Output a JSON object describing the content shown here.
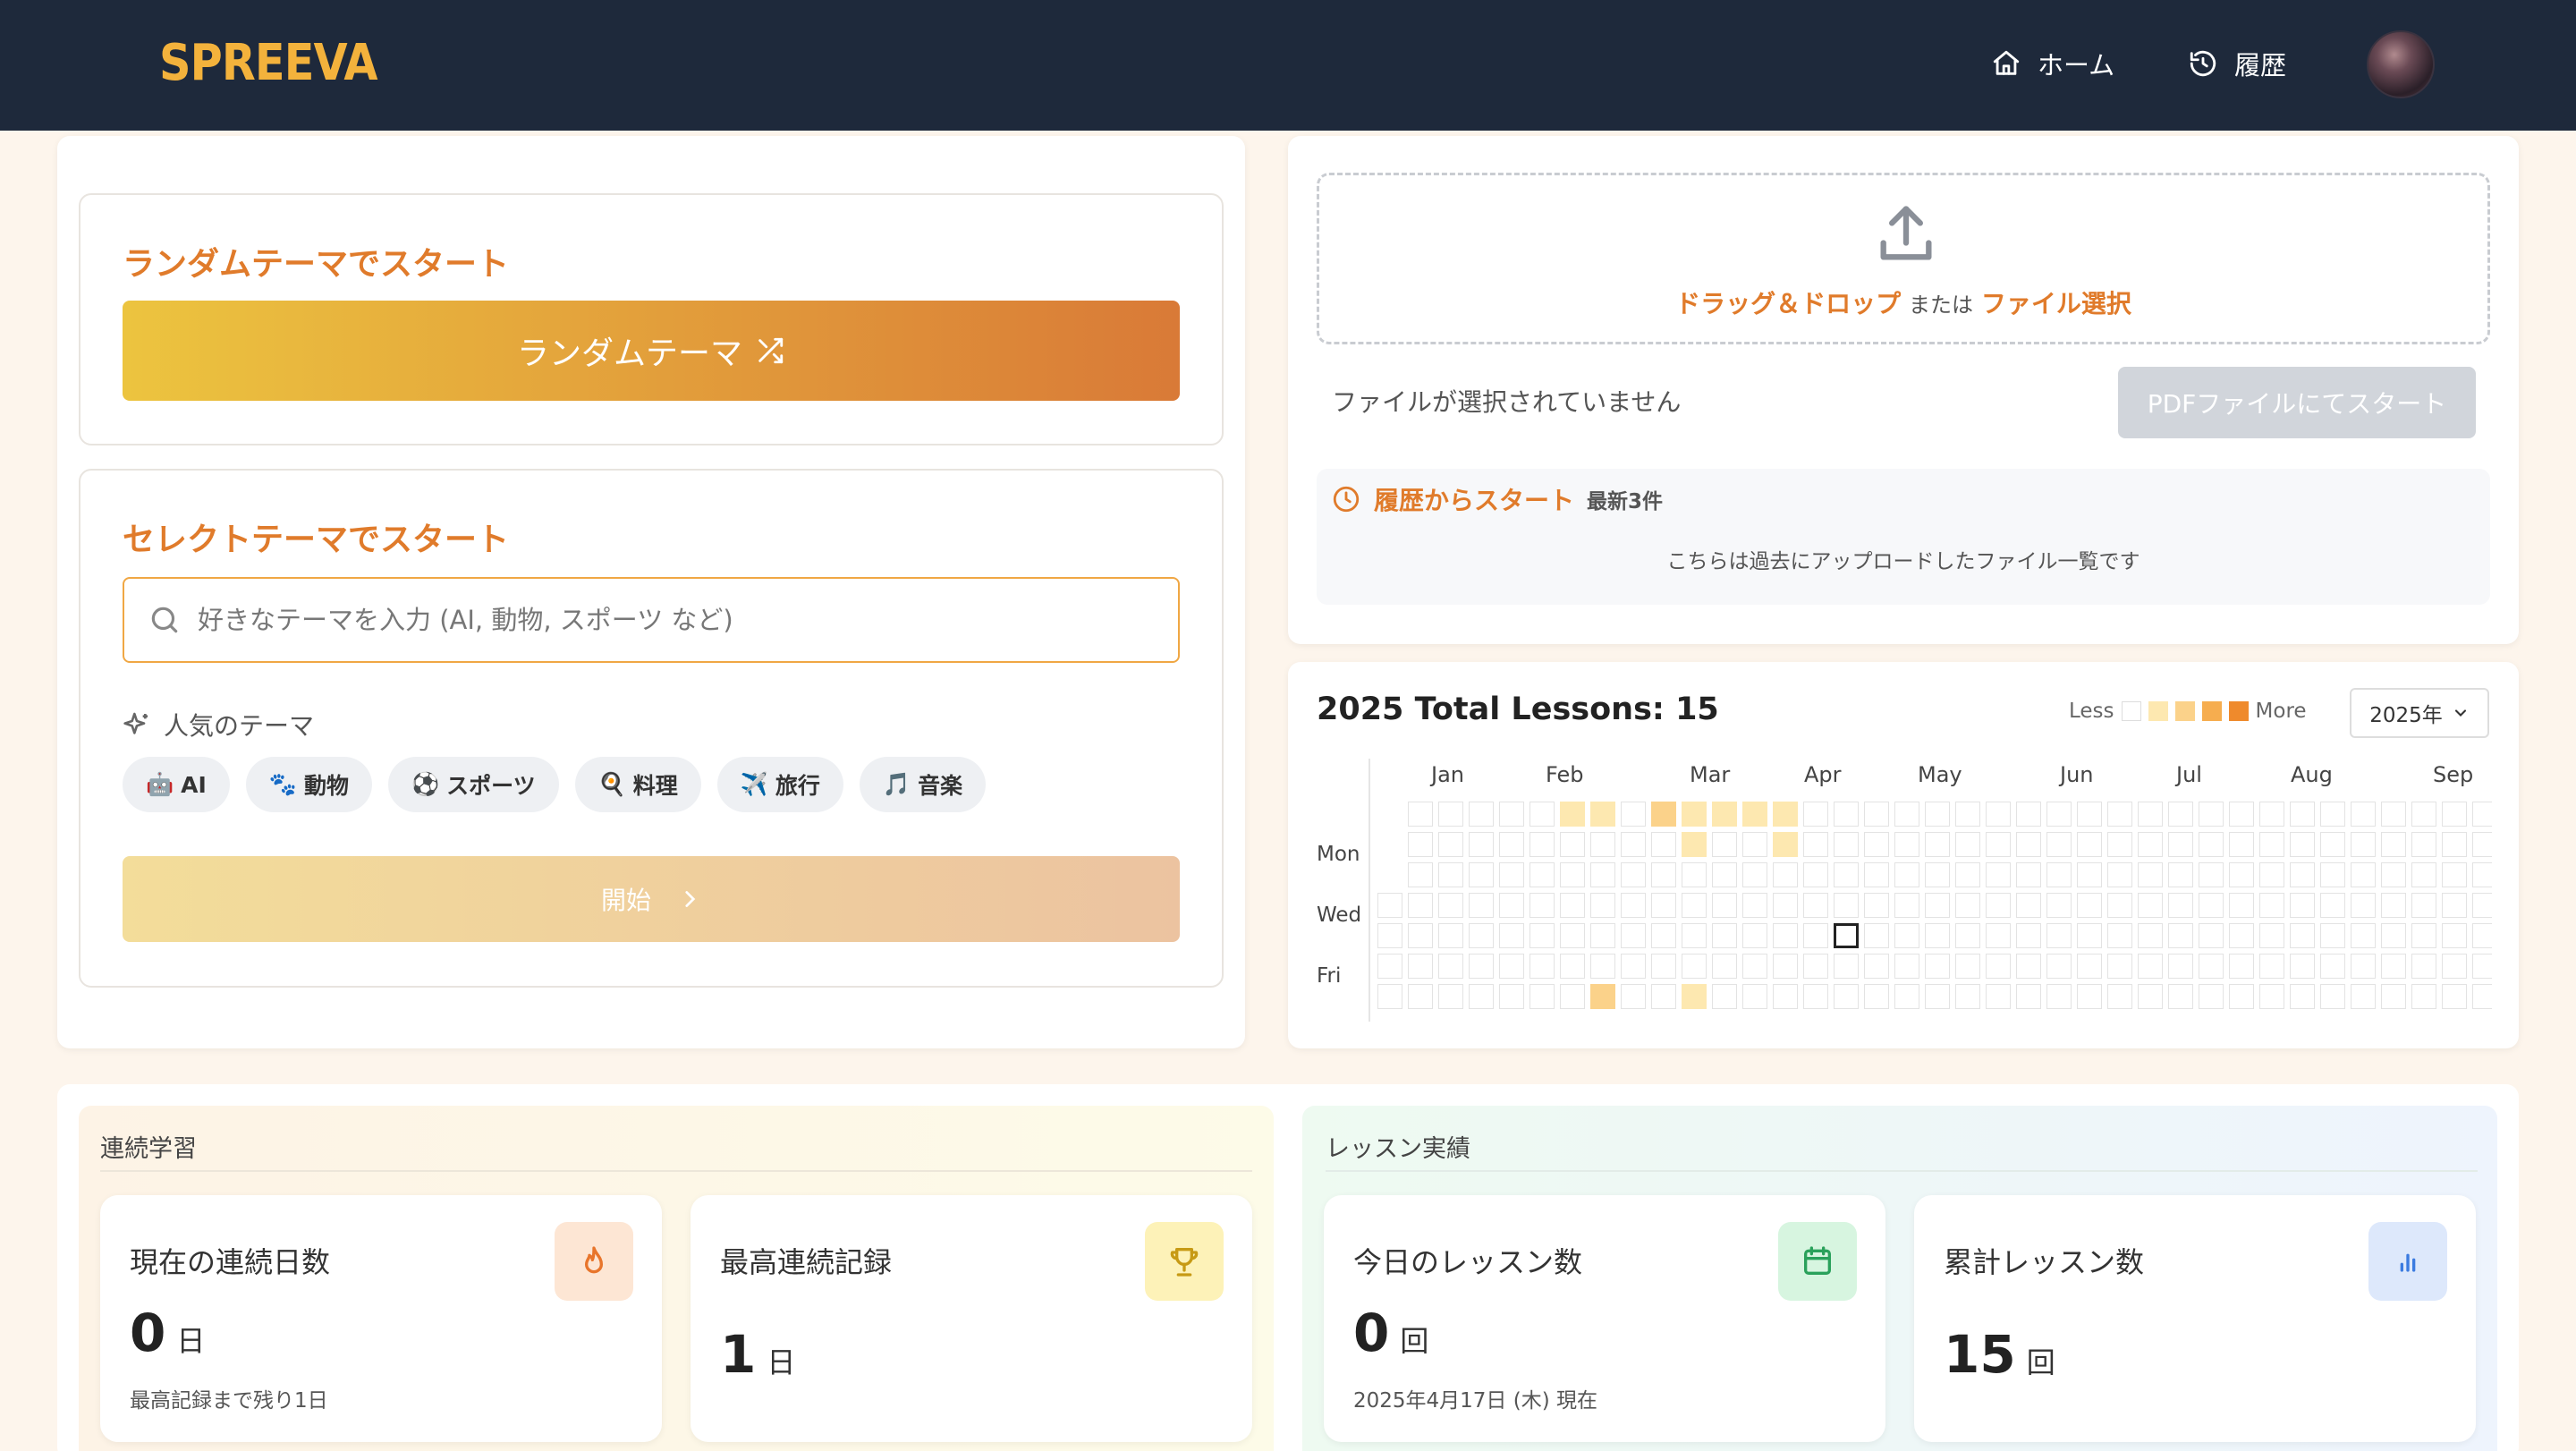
{
  "header": {
    "logo": "SPREEVA",
    "nav": [
      {
        "label": "ホーム",
        "icon": "home-icon"
      },
      {
        "label": "履歴",
        "icon": "history-icon"
      }
    ]
  },
  "random": {
    "title": "ランダムテーマでスタート",
    "button_label": "ランダムテーマ"
  },
  "select": {
    "title": "セレクトテーマでスタート",
    "search_placeholder": "好きなテーマを入力 (AI, 動物, スポーツ など)",
    "popular_label": "人気のテーマ",
    "chips": [
      {
        "emoji": "🤖",
        "label": "AI"
      },
      {
        "emoji": "🐾",
        "label": "動物"
      },
      {
        "emoji": "⚽",
        "label": "スポーツ"
      },
      {
        "emoji": "🍳",
        "label": "料理"
      },
      {
        "emoji": "✈️",
        "label": "旅行"
      },
      {
        "emoji": "🎵",
        "label": "音楽"
      }
    ],
    "start_label": "開始"
  },
  "upload": {
    "drag_label": "ドラッグ＆ドロップ",
    "or_label": "または",
    "file_select_label": "ファイル選択",
    "no_file_text": "ファイルが選択されていません",
    "pdf_button_label": "PDFファイルにてスタート"
  },
  "history": {
    "title": "履歴からスタート",
    "subtitle": "最新3件",
    "description": "こちらは過去にアップロードしたファイル一覧です"
  },
  "calendar": {
    "title": "2025 Total Lessons: 15",
    "legend_less": "Less",
    "legend_more": "More",
    "legend_colors": [
      "#ffffff",
      "#fde8b0",
      "#fbd28a",
      "#f6ad4f",
      "#ef8a2c"
    ],
    "year_select": "2025年",
    "months": [
      "Jan",
      "Feb",
      "Mar",
      "Apr",
      "May",
      "Jun",
      "Jul",
      "Aug",
      "Sep"
    ],
    "day_labels": [
      "Mon",
      "Wed",
      "Fri"
    ],
    "active_days": [
      {
        "date": "2025-02-09",
        "level": 1
      },
      {
        "date": "2025-02-16",
        "level": 1
      },
      {
        "date": "2025-02-22",
        "level": 2
      },
      {
        "date": "2025-03-02",
        "level": 2
      },
      {
        "date": "2025-03-09",
        "level": 1
      },
      {
        "date": "2025-03-10",
        "level": 1
      },
      {
        "date": "2025-03-15",
        "level": 1
      },
      {
        "date": "2025-03-16",
        "level": 1
      },
      {
        "date": "2025-03-23",
        "level": 1
      },
      {
        "date": "2025-03-30",
        "level": 1
      },
      {
        "date": "2025-03-31",
        "level": 1
      }
    ],
    "today": "2025-04-17"
  },
  "streak": {
    "section_title": "連続学習",
    "current": {
      "label": "現在の連続日数",
      "value": "0",
      "unit": "日",
      "note": "最高記録まで残り1日"
    },
    "best": {
      "label": "最高連続記録",
      "value": "1",
      "unit": "日"
    }
  },
  "lessons": {
    "section_title": "レッスン実績",
    "today": {
      "label": "今日のレッスン数",
      "value": "0",
      "unit": "回",
      "note": "2025年4月17日 (木) 現在"
    },
    "total": {
      "label": "累計レッスン数",
      "value": "15",
      "unit": "回"
    }
  }
}
